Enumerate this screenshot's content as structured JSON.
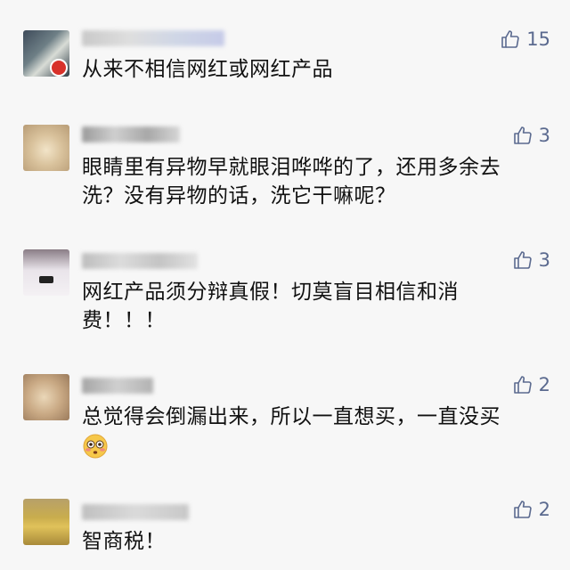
{
  "comments": [
    {
      "text_lines": [
        "从来不相信网红或网红产品"
      ],
      "likes": "15",
      "icon": "thumbs-up-icon",
      "avatar": "avatar-blurred"
    },
    {
      "text_lines": [
        "眼睛里有异物早就眼泪哗哗的了，还用多余去",
        "洗？没有异物的话，洗它干嘛呢？"
      ],
      "likes": "3",
      "icon": "thumbs-up-icon",
      "avatar": "avatar-blurred"
    },
    {
      "text_lines": [
        "网红产品须分辩真假！切莫盲目相信和消",
        "费！！！"
      ],
      "likes": "3",
      "icon": "thumbs-up-icon",
      "avatar": "avatar-blurred"
    },
    {
      "text_lines": [
        "总觉得会倒漏出来，所以一直想买，一直没买"
      ],
      "likes": "2",
      "icon": "thumbs-up-icon",
      "avatar": "avatar-blurred",
      "emoji": "flushed-face-emoji"
    },
    {
      "text_lines": [
        "智商税！"
      ],
      "likes": "2",
      "icon": "thumbs-up-icon",
      "avatar": "avatar-blurred"
    }
  ],
  "colors": {
    "background": "#f7f7f7",
    "text": "#111111",
    "like": "#5b6a8f"
  }
}
